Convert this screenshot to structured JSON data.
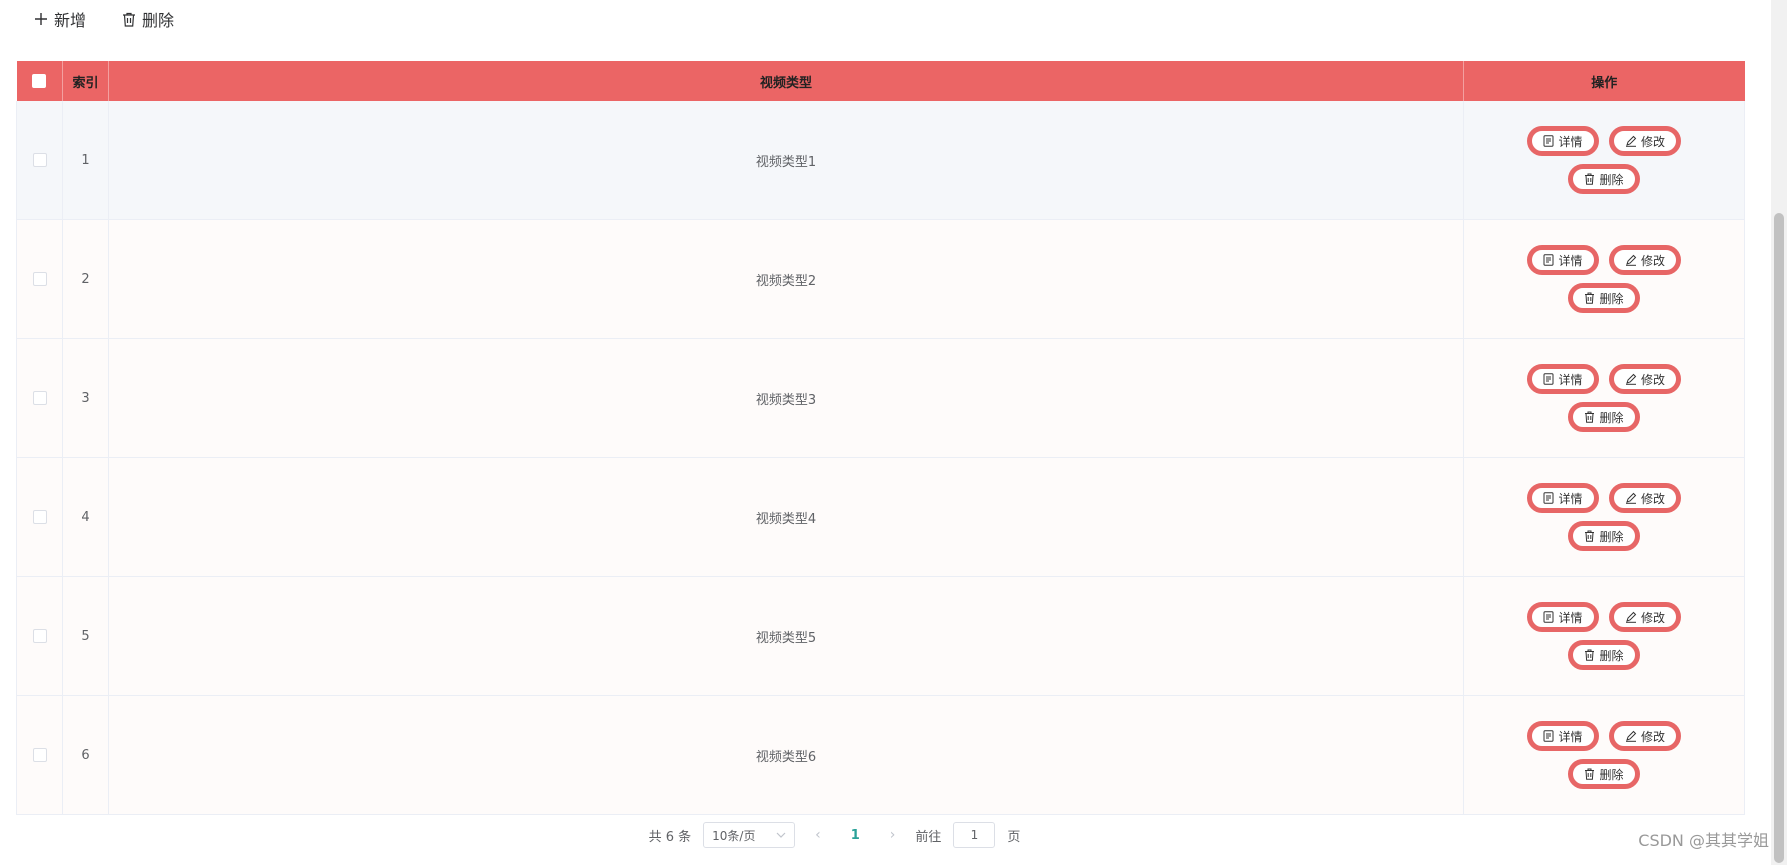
{
  "toolbar": {
    "add_label": "新增",
    "delete_label": "删除"
  },
  "table": {
    "headers": {
      "index": "索引",
      "type": "视频类型",
      "ops": "操作"
    },
    "rows": [
      {
        "index": "1",
        "type": "视频类型1"
      },
      {
        "index": "2",
        "type": "视频类型2"
      },
      {
        "index": "3",
        "type": "视频类型3"
      },
      {
        "index": "4",
        "type": "视频类型4"
      },
      {
        "index": "5",
        "type": "视频类型5"
      },
      {
        "index": "6",
        "type": "视频类型6"
      }
    ],
    "row_actions": {
      "detail": "详情",
      "edit": "修改",
      "delete": "删除"
    }
  },
  "pagination": {
    "total_text": "共 6 条",
    "page_size": "10条/页",
    "current_page": "1",
    "goto_label": "前往",
    "goto_value": "1",
    "goto_suffix": "页"
  },
  "watermark": "CSDN @其其学姐",
  "colors": {
    "header_bg": "#eb6565",
    "button_border": "#e76666",
    "active_page": "#2aa198"
  }
}
